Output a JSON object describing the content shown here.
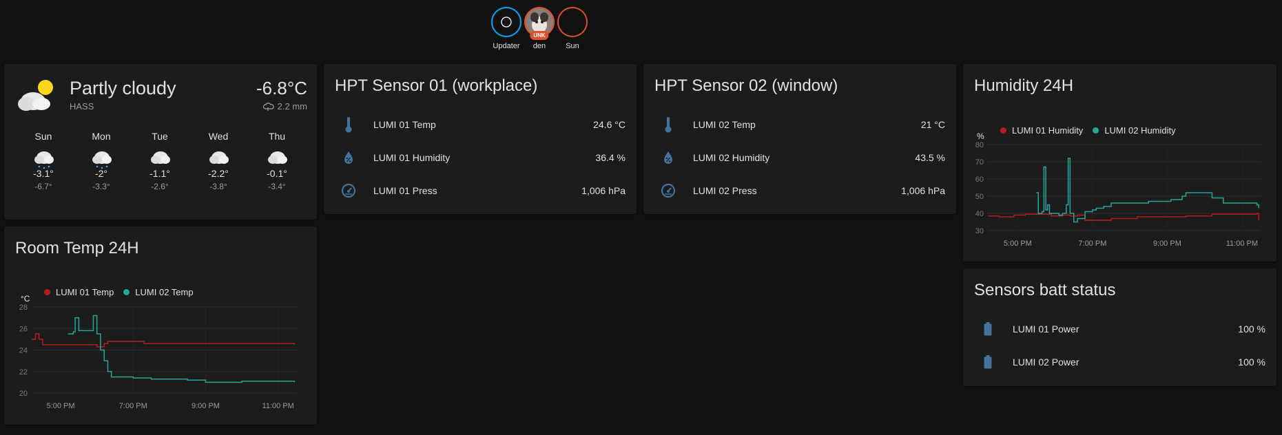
{
  "colors": {
    "accent": "#03a9f4",
    "red": "#b71c1c",
    "teal": "#26a69a",
    "icon": "#44739e",
    "unk": "#e0502a"
  },
  "badges": [
    {
      "label": "Updater",
      "icon": "ring-icon"
    },
    {
      "label": "den",
      "tag": "UNK",
      "icon": "avatar"
    },
    {
      "label": "Sun",
      "icon": "moon-icon"
    }
  ],
  "weather": {
    "condition": "Partly cloudy",
    "source": "HASS",
    "temperature": "-6.8°C",
    "precipitation": "2.2 mm",
    "forecast": [
      {
        "day": "Sun",
        "high": "-3.1°",
        "low": "-6.7°",
        "icon": "snow"
      },
      {
        "day": "Mon",
        "high": "-2°",
        "low": "-3.3°",
        "icon": "snow"
      },
      {
        "day": "Tue",
        "high": "-1.1°",
        "low": "-2.6°",
        "icon": "cloudy"
      },
      {
        "day": "Wed",
        "high": "-2.2°",
        "low": "-3.8°",
        "icon": "cloudy"
      },
      {
        "day": "Thu",
        "high": "-0.1°",
        "low": "-3.4°",
        "icon": "cloudy"
      }
    ]
  },
  "sensor1": {
    "title": "HPT Sensor 01 (workplace)",
    "rows": [
      {
        "name": "LUMI 01 Temp",
        "value": "24.6 °C",
        "icon": "thermometer-icon"
      },
      {
        "name": "LUMI 01 Humidity",
        "value": "36.4 %",
        "icon": "water-percent-icon"
      },
      {
        "name": "LUMI 01 Press",
        "value": "1,006 hPa",
        "icon": "gauge-icon"
      }
    ]
  },
  "sensor2": {
    "title": "HPT Sensor 02 (window)",
    "rows": [
      {
        "name": "LUMI 02 Temp",
        "value": "21 °C",
        "icon": "thermometer-icon"
      },
      {
        "name": "LUMI 02 Humidity",
        "value": "43.5 %",
        "icon": "water-percent-icon"
      },
      {
        "name": "LUMI 02 Press",
        "value": "1,006 hPa",
        "icon": "gauge-icon"
      }
    ]
  },
  "battery": {
    "title": "Sensors batt status",
    "rows": [
      {
        "name": "LUMI 01 Power",
        "value": "100 %",
        "icon": "battery-icon"
      },
      {
        "name": "LUMI 02 Power",
        "value": "100 %",
        "icon": "battery-icon"
      }
    ]
  },
  "chart_data": [
    {
      "type": "line",
      "title": "Humidity 24H",
      "ylabel": "%",
      "ylim": [
        30,
        80
      ],
      "yticks": [
        30,
        40,
        50,
        60,
        70,
        80
      ],
      "xlim": [
        16.2,
        23.5
      ],
      "xticks": [
        {
          "x": 17,
          "label": "5:00 PM"
        },
        {
          "x": 19,
          "label": "7:00 PM"
        },
        {
          "x": 21,
          "label": "9:00 PM"
        },
        {
          "x": 23,
          "label": "11:00 PM"
        }
      ],
      "grid": true,
      "legend": "top-left",
      "series": [
        {
          "name": "LUMI 01 Humidity",
          "color": "#b71c1c",
          "points": [
            [
              16.2,
              38.5
            ],
            [
              16.5,
              38
            ],
            [
              16.9,
              39
            ],
            [
              17.2,
              39.5
            ],
            [
              17.6,
              39.5
            ],
            [
              17.9,
              38.5
            ],
            [
              18.2,
              39
            ],
            [
              18.4,
              38.5
            ],
            [
              18.6,
              39
            ],
            [
              18.8,
              36
            ],
            [
              19.5,
              37
            ],
            [
              20.2,
              38
            ],
            [
              21.5,
              38.5
            ],
            [
              22.2,
              39.5
            ],
            [
              23.4,
              40
            ],
            [
              23.45,
              36
            ]
          ]
        },
        {
          "name": "LUMI 02 Humidity",
          "color": "#26a69a",
          "points": [
            [
              17.5,
              52
            ],
            [
              17.55,
              40
            ],
            [
              17.65,
              41
            ],
            [
              17.7,
              67
            ],
            [
              17.75,
              42
            ],
            [
              17.8,
              45
            ],
            [
              17.85,
              40
            ],
            [
              18.0,
              40
            ],
            [
              18.1,
              39
            ],
            [
              18.2,
              40
            ],
            [
              18.3,
              45
            ],
            [
              18.35,
              72
            ],
            [
              18.4,
              40
            ],
            [
              18.5,
              35
            ],
            [
              18.6,
              37
            ],
            [
              18.8,
              41
            ],
            [
              19.0,
              42
            ],
            [
              19.1,
              43
            ],
            [
              19.3,
              44
            ],
            [
              19.5,
              46
            ],
            [
              20.2,
              46
            ],
            [
              20.5,
              47
            ],
            [
              21.1,
              48
            ],
            [
              21.4,
              50
            ],
            [
              21.5,
              52
            ],
            [
              21.9,
              52
            ],
            [
              22.2,
              49
            ],
            [
              22.5,
              46
            ],
            [
              23.4,
              45
            ],
            [
              23.45,
              43
            ]
          ]
        }
      ]
    },
    {
      "type": "line",
      "title": "Room Temp 24H",
      "ylabel": "°C",
      "ylim": [
        20,
        28
      ],
      "yticks": [
        20,
        22,
        24,
        26,
        28
      ],
      "xlim": [
        16.2,
        23.5
      ],
      "xticks": [
        {
          "x": 17,
          "label": "5:00 PM"
        },
        {
          "x": 19,
          "label": "7:00 PM"
        },
        {
          "x": 21,
          "label": "9:00 PM"
        },
        {
          "x": 23,
          "label": "11:00 PM"
        }
      ],
      "grid": true,
      "legend": "top-left",
      "series": [
        {
          "name": "LUMI 01 Temp",
          "color": "#b71c1c",
          "points": [
            [
              16.2,
              25
            ],
            [
              16.3,
              25.5
            ],
            [
              16.4,
              25
            ],
            [
              16.5,
              24.5
            ],
            [
              17.2,
              24.5
            ],
            [
              17.8,
              24.5
            ],
            [
              18.0,
              24.3
            ],
            [
              18.2,
              24.6
            ],
            [
              18.3,
              24.8
            ],
            [
              19.1,
              24.8
            ],
            [
              19.3,
              24.6
            ],
            [
              23.45,
              24.5
            ]
          ]
        },
        {
          "name": "LUMI 02 Temp",
          "color": "#26a69a",
          "points": [
            [
              17.2,
              25.5
            ],
            [
              17.35,
              25.7
            ],
            [
              17.4,
              27
            ],
            [
              17.5,
              25.8
            ],
            [
              17.8,
              25.8
            ],
            [
              17.9,
              27.2
            ],
            [
              18.0,
              25.5
            ],
            [
              18.1,
              24
            ],
            [
              18.2,
              23
            ],
            [
              18.3,
              22
            ],
            [
              18.4,
              21.5
            ],
            [
              19.0,
              21.4
            ],
            [
              19.5,
              21.3
            ],
            [
              20.5,
              21.2
            ],
            [
              21.0,
              21
            ],
            [
              22.0,
              21.1
            ],
            [
              23.45,
              21
            ]
          ]
        }
      ]
    }
  ]
}
